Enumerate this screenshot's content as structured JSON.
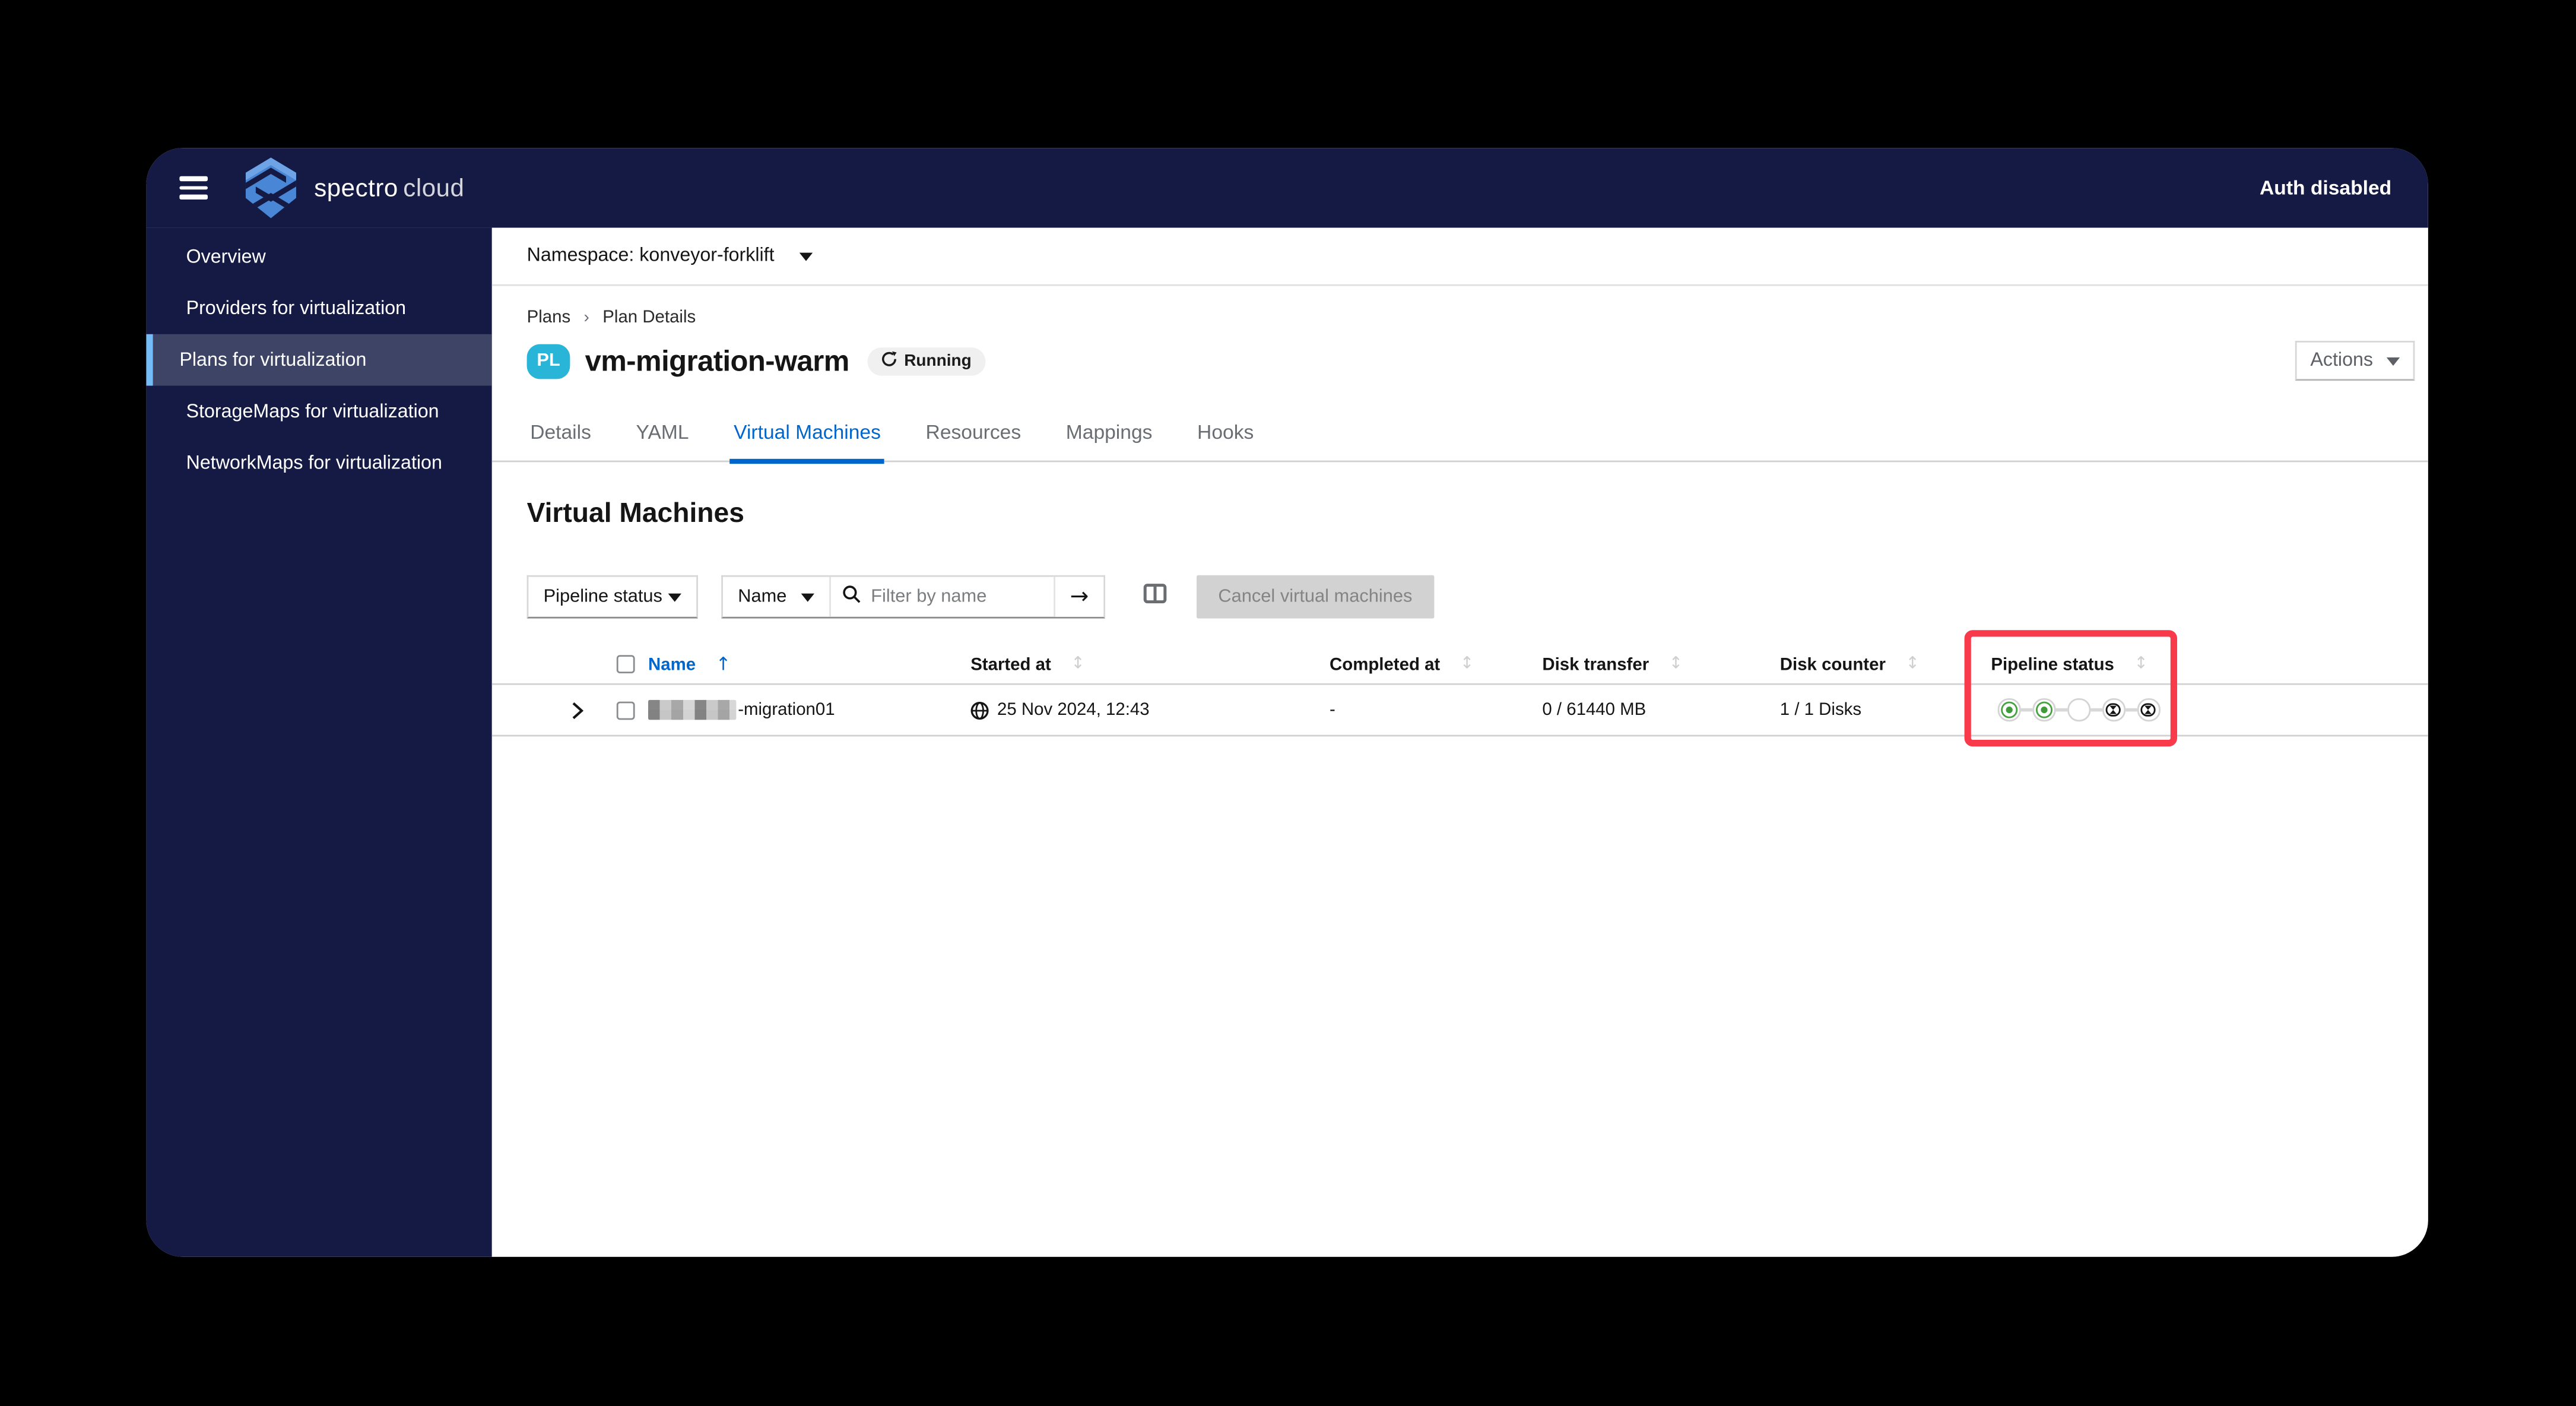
{
  "header": {
    "brand_primary": "spectro",
    "brand_secondary": "cloud",
    "auth_status": "Auth disabled"
  },
  "sidebar": {
    "items": [
      {
        "label": "Overview",
        "active": false
      },
      {
        "label": "Providers for virtualization",
        "active": false
      },
      {
        "label": "Plans for virtualization",
        "active": true
      },
      {
        "label": "StorageMaps for virtualization",
        "active": false
      },
      {
        "label": "NetworkMaps for virtualization",
        "active": false
      }
    ]
  },
  "namespace_bar": {
    "label": "Namespace: konveyor-forklift"
  },
  "breadcrumb": {
    "items": [
      {
        "label": "Plans"
      },
      {
        "label": "Plan Details"
      }
    ]
  },
  "plan_header": {
    "badge": "PL",
    "title": "vm-migration-warm",
    "status_label": "Running",
    "actions_label": "Actions"
  },
  "tabs": {
    "active": "Virtual Machines",
    "items": [
      {
        "label": "Details"
      },
      {
        "label": "YAML"
      },
      {
        "label": "Virtual Machines"
      },
      {
        "label": "Resources"
      },
      {
        "label": "Mappings"
      },
      {
        "label": "Hooks"
      }
    ]
  },
  "section": {
    "heading": "Virtual Machines"
  },
  "filters": {
    "pipeline_status_select": "Pipeline status",
    "attribute_select": "Name",
    "search_placeholder": "Filter by name",
    "go_arrow": "→",
    "cancel_button_label": "Cancel virtual machines"
  },
  "table": {
    "columns": [
      "Name",
      "Started at",
      "Completed at",
      "Disk transfer",
      "Disk counter",
      "Pipeline status"
    ],
    "sort": {
      "column": "Name",
      "direction": "asc",
      "asc_glyph": "↑",
      "idle_glyph": "↕"
    },
    "rows": [
      {
        "name_prefix_redacted": true,
        "name_suffix": "-migration01",
        "started_at": "25 Nov 2024, 12:43",
        "completed_at": "-",
        "disk_transfer": "0 / 61440 MB",
        "disk_counter": "1 / 1 Disks",
        "pipeline_status_steps": [
          "success",
          "success",
          "current",
          "pending",
          "pending"
        ]
      }
    ]
  },
  "annotation": {
    "shape": "highlight-rectangle",
    "color": "#f83a4a",
    "target": "pipeline-status-column"
  },
  "colors": {
    "navy": "#151a45",
    "sidebar_active_bg": "#3d4466",
    "sidebar_active_border": "#73bcf7",
    "accent_blue": "#0066cc",
    "badge_cyan": "#29b5d8",
    "success_green": "#46a23f",
    "annotation_red": "#f83a4a",
    "disabled_bg": "#d2d2d2"
  }
}
